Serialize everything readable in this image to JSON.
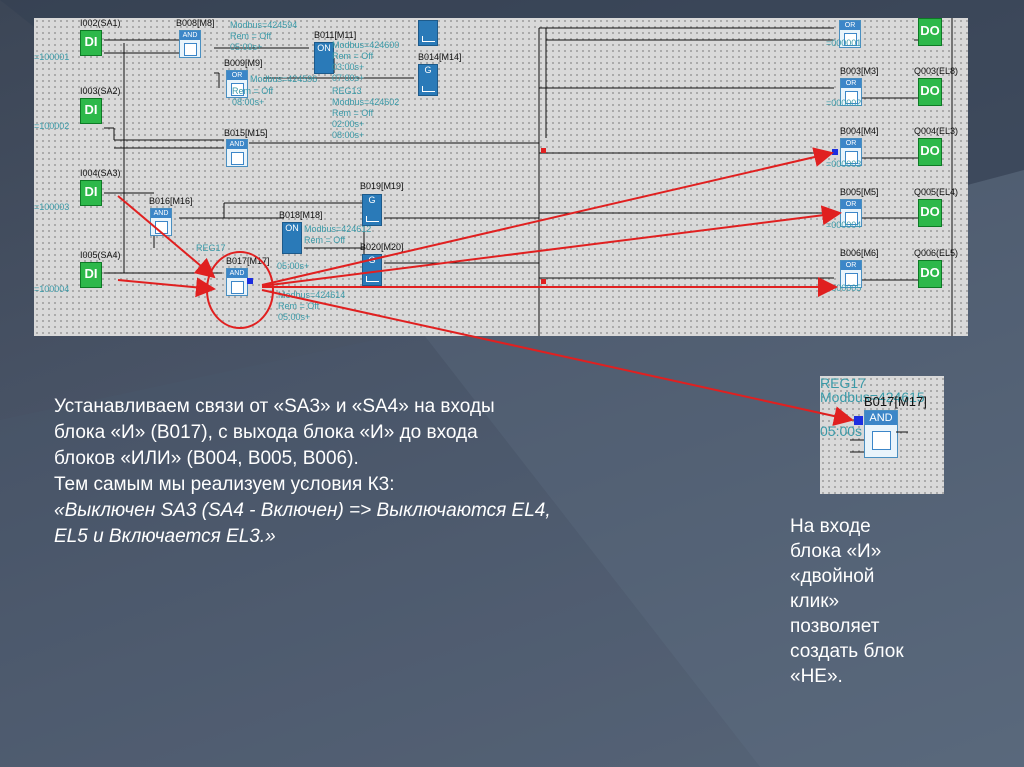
{
  "diagram": {
    "inputs": [
      {
        "id": "I002(SA1)",
        "type": "DI",
        "counter": "=100001"
      },
      {
        "id": "I003(SA2)",
        "type": "DI",
        "counter": "=100002"
      },
      {
        "id": "I004(SA3)",
        "type": "DI",
        "counter": "=100003"
      },
      {
        "id": "I005(SA4)",
        "type": "DI",
        "counter": "=100004"
      }
    ],
    "blocks": {
      "b008": "B008[M8]",
      "b009": "B009[M9]",
      "b011": "B011[M11]",
      "b014": "B014[M14]",
      "b015": "B015[M15]",
      "b016": "B016[M16]",
      "b017": "B017[M17]",
      "b018": "B018[M18]",
      "b019": "B019[M19]",
      "b020": "B020[M20]",
      "b003": "B003[M3]",
      "b004": "B004[M4]",
      "b005": "B005[M5]",
      "b006": "B006[M6]"
    },
    "outputs": [
      {
        "id": "Q003(EL8)",
        "type": "DO"
      },
      {
        "id": "Q004(EL3)",
        "type": "DO"
      },
      {
        "id": "Q005(EL4)",
        "type": "DO"
      },
      {
        "id": "Q006(EL5)",
        "type": "DO"
      }
    ],
    "teal_texts": {
      "t1": "Modbus=424594",
      "t2": "Rem = Off",
      "t3": "05:00s+",
      "t4": "Modbus=424600",
      "t5": "Rem = Off",
      "t6": "03:00s+",
      "t7": "07:00s+",
      "t8": "Modbus=424596",
      "t9": "Rem = Off",
      "t10": "08:00s+",
      "t11": "REG13",
      "t12": "Modbus=424602",
      "t13": "Rem = Off",
      "t14": "02:00s+",
      "t15": "08:00s+",
      "t16": "Modbus=424612",
      "t17": "Rem = Off",
      "t18": "05:00s+",
      "t19": "REG17",
      "t20": "Modbus=424614",
      "t21": "Rem = Off",
      "t22": "05:00s+",
      "o1": "=000001",
      "o2": "=000002",
      "o3": "=000003",
      "o4": "=000004",
      "o5": "=000005"
    },
    "gate_labels": {
      "and": "AND",
      "or": "OR",
      "g": "G",
      "on": "ON",
      "di": "DI",
      "do": "DO"
    }
  },
  "main_text": {
    "line1": "Устанавливаем связи от «SA3» и «SA4» на входы",
    "line2": "блока «И» (B017), с выхода блока «И» до входа",
    "line3": "блоков «ИЛИ» (B004, B005, B006).",
    "line4": " Тем самым мы реализуем условия К3:",
    "line5": "«Выключен SA3 (SA4 - Включен) => Выключаются EL4,",
    "line6": "EL5 и Включается EL3.»"
  },
  "side_text": {
    "line1": "На входе",
    "line2": "блока «И»",
    "line3": "«двойной",
    "line4": "клик»",
    "line5": "позволяет",
    "line6": "создать блок",
    "line7": "«НЕ»."
  },
  "zoom": {
    "reg": "REG17",
    "modbus": "Modbus=424615",
    "time": "05:00s",
    "block": "B017[M17]",
    "gate": "AND"
  },
  "colors": {
    "background": "#4a5568",
    "arrow": "#e02020",
    "gate_blue": "#3c86c8",
    "io_green": "#2db84a",
    "teal": "#3a9aa8"
  }
}
